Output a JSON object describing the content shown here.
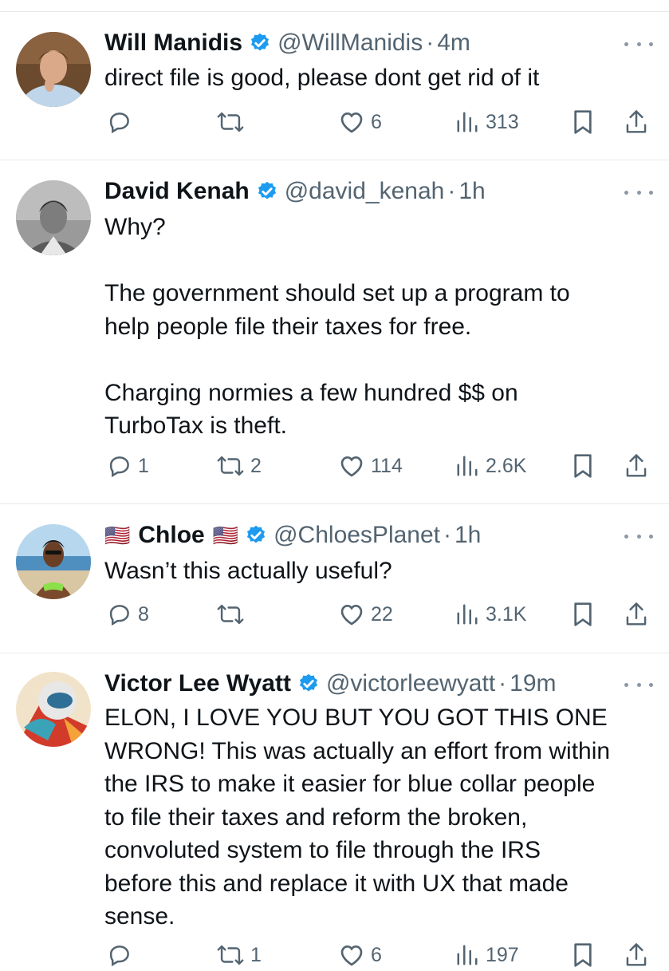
{
  "tweets": [
    {
      "name": "Will Manidis",
      "handle": "@WillManidis",
      "sep": "·",
      "time": "4m",
      "text": "direct file is good, please dont get rid of it",
      "replies": "",
      "retweets": "",
      "likes": "6",
      "views": "313"
    },
    {
      "name": "David Kenah",
      "handle": "@david_kenah",
      "sep": "·",
      "time": "1h",
      "text": "Why?\n\nThe government should set up a program to\nhelp people file their taxes for free.\n\nCharging normies a few hundred $$ on\nTurboTax is theft.",
      "replies": "1",
      "retweets": "2",
      "likes": "114",
      "views": "2.6K"
    },
    {
      "name_flag_left": "🇺🇸",
      "name": "Chloe",
      "name_flag_right": "🇺🇸",
      "handle": "@ChloesPlanet",
      "sep": "·",
      "time": "1h",
      "text": "Wasn’t this actually useful?",
      "replies": "8",
      "retweets": "",
      "likes": "22",
      "views": "3.1K"
    },
    {
      "name": "Victor Lee Wyatt",
      "handle": "@victorleewyatt",
      "sep": "·",
      "time": "19m",
      "text": "ELON, I LOVE YOU BUT YOU GOT THIS ONE\nWRONG! This was actually an effort from within\nthe IRS to make it easier for blue collar people\nto file their taxes and reform the broken,\nconvoluted system to file through the IRS\nbefore this and replace it with UX that made\nsense.",
      "replies": "",
      "retweets": "1",
      "likes": "6",
      "views": "197"
    }
  ],
  "icons": {
    "reply": "reply-icon",
    "retweet": "retweet-icon",
    "like": "heart-icon",
    "views": "views-icon",
    "bookmark": "bookmark-icon",
    "share": "share-icon",
    "verified": "verified-badge-icon",
    "more": "more-icon"
  },
  "colors": {
    "text": "#0f1419",
    "secondary": "#536471",
    "verified": "#1d9bf0",
    "divider": "#e7e9ea"
  }
}
